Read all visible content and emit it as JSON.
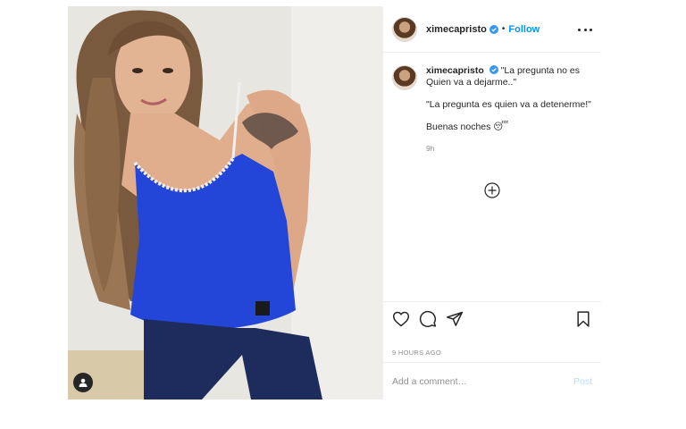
{
  "header": {
    "username": "ximecapristo",
    "separator": "•",
    "follow_label": "Follow"
  },
  "caption": {
    "username": "ximecapristo",
    "line1": "\"La pregunta no es Quien va a dejarme..\"",
    "line2": "\"La pregunta es quien va a detenerme!\"",
    "line3": "Buenas noches 😴",
    "time": "9h"
  },
  "footer": {
    "timestamp": "9 HOURS AGO",
    "comment_placeholder": "Add a comment…",
    "post_label": "Post"
  },
  "icons": {
    "verified": "verified-badge-icon",
    "more": "more-options-icon",
    "load_more": "plus-circle-icon",
    "like": "heart-icon",
    "comment": "comment-bubble-icon",
    "share": "paper-plane-icon",
    "save": "bookmark-icon",
    "user_tag": "user-tag-icon"
  },
  "colors": {
    "accent": "#0095f6",
    "text": "#262626",
    "muted": "#8e8e8e",
    "post_disabled": "#b2dffc",
    "border": "#efefef"
  }
}
